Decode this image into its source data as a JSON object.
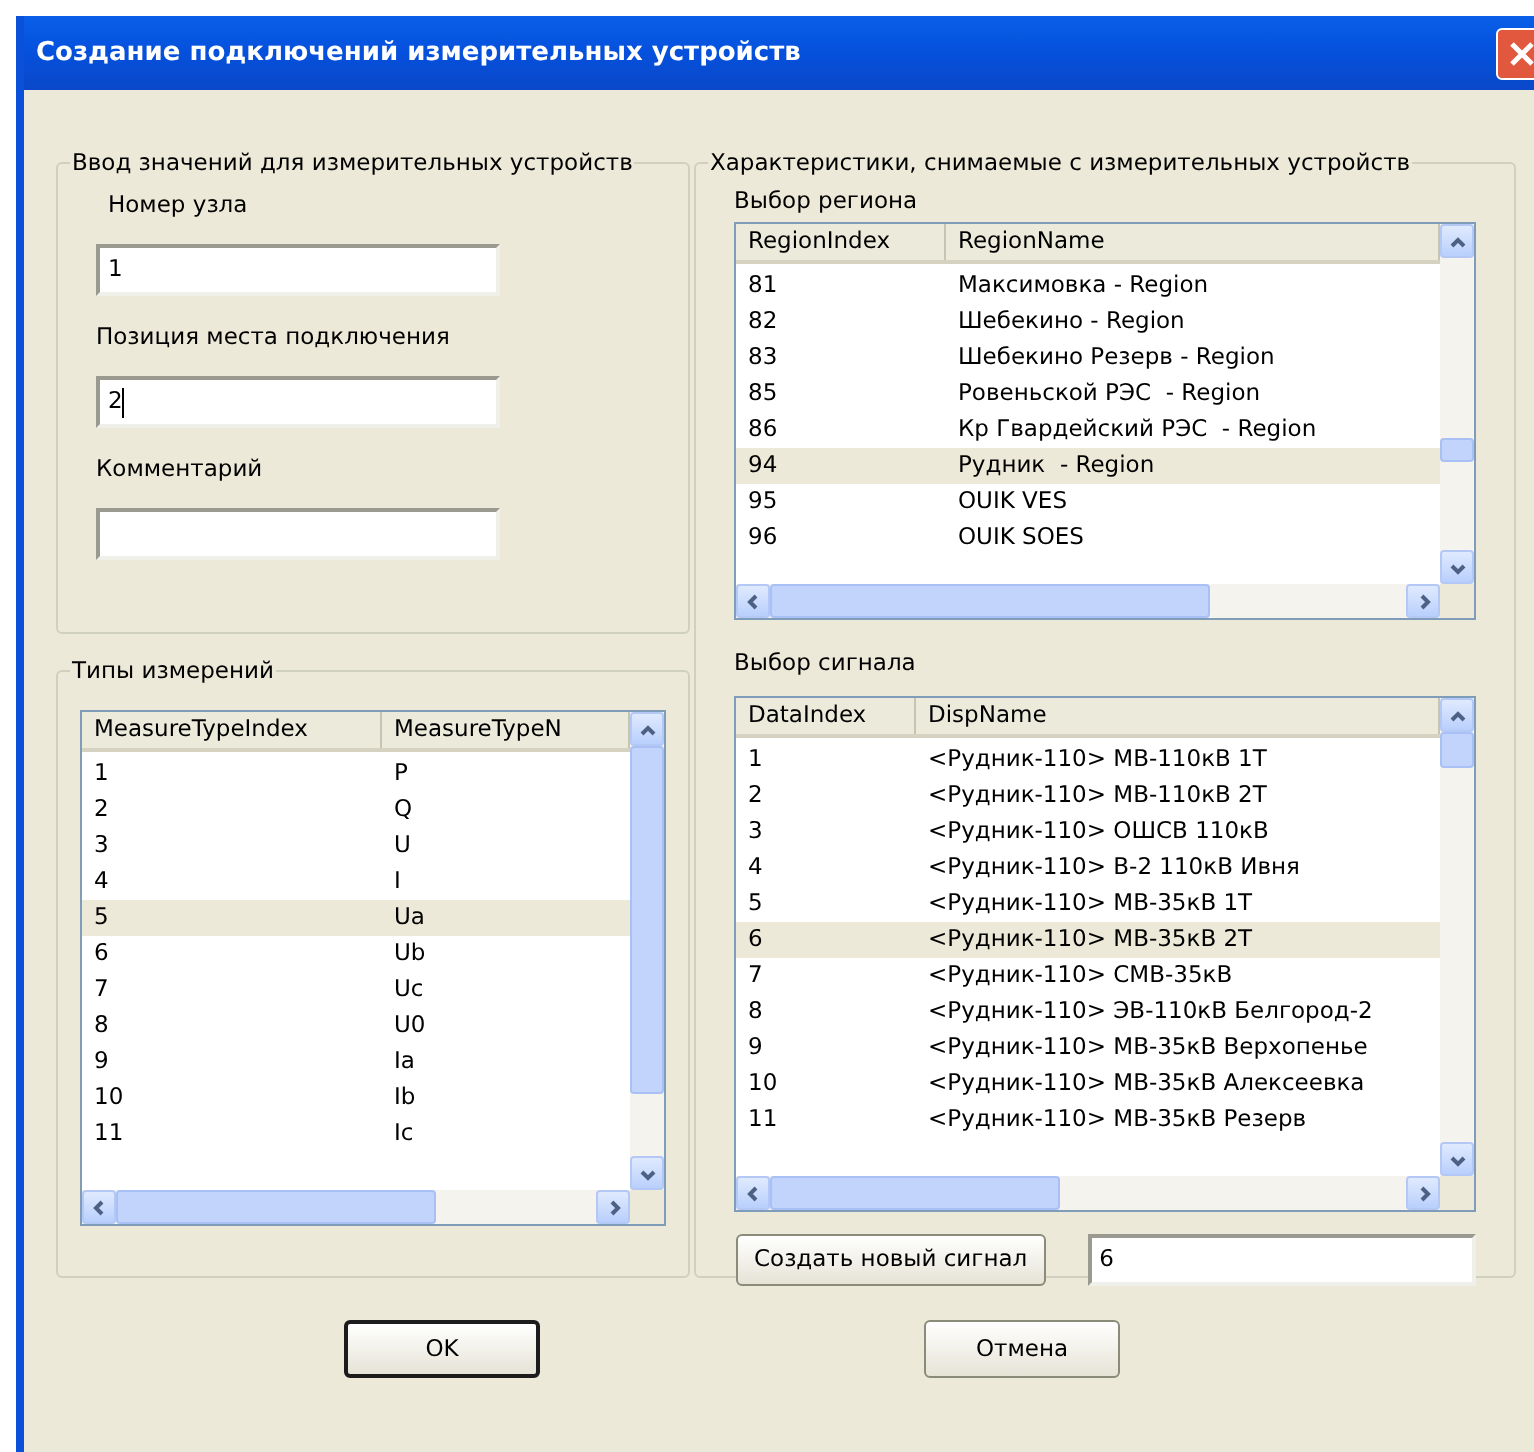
{
  "window": {
    "title": "Создание подключений измерительных устройств"
  },
  "input_group": {
    "title": "Ввод значений для измерительных устройств",
    "fields": [
      {
        "label": "Номер узла",
        "value": "1",
        "focused": false
      },
      {
        "label": "Позиция места подключения",
        "value": "2",
        "focused": true
      },
      {
        "label": "Комментарий",
        "focused": false
      }
    ]
  },
  "measure_types": {
    "title": "Типы измерений",
    "columns": [
      "MeasureTypeIndex",
      "MeasureTypeN"
    ],
    "rows": [
      {
        "cells": [
          "1",
          "P"
        ],
        "selected": false
      },
      {
        "cells": [
          "2",
          "Q"
        ],
        "selected": false
      },
      {
        "cells": [
          "3",
          "U"
        ],
        "selected": false
      },
      {
        "cells": [
          "4",
          "I"
        ],
        "selected": false
      },
      {
        "cells": [
          "5",
          "Ua"
        ],
        "selected": true
      },
      {
        "cells": [
          "6",
          "Ub"
        ],
        "selected": false
      },
      {
        "cells": [
          "7",
          "Uc"
        ],
        "selected": false
      },
      {
        "cells": [
          "8",
          "U0"
        ],
        "selected": false
      },
      {
        "cells": [
          "9",
          "Ia"
        ],
        "selected": false
      },
      {
        "cells": [
          "10",
          "Ib"
        ],
        "selected": false
      },
      {
        "cells": [
          "11",
          "Ic"
        ],
        "selected": false
      }
    ]
  },
  "characteristics": {
    "title": "Характеристики, снимаемые с измерительных устройств",
    "region": {
      "label": "Выбор региона",
      "columns": [
        "RegionIndex",
        "RegionName"
      ],
      "rows": [
        {
          "cells": [
            "81",
            "Максимовка - Region"
          ],
          "selected": false
        },
        {
          "cells": [
            "82",
            "Шебекино - Region"
          ],
          "selected": false
        },
        {
          "cells": [
            "83",
            "Шебекино Резерв - Region"
          ],
          "selected": false
        },
        {
          "cells": [
            "85",
            "Ровеньской РЭС  - Region"
          ],
          "selected": false
        },
        {
          "cells": [
            "86",
            "Кр Гвардейский РЭС  - Region"
          ],
          "selected": false
        },
        {
          "cells": [
            "94",
            "Рудник  - Region"
          ],
          "selected": true
        },
        {
          "cells": [
            "95",
            "OUIK VES"
          ],
          "selected": false
        },
        {
          "cells": [
            "96",
            "OUIK SOES"
          ],
          "selected": false
        }
      ]
    },
    "signal": {
      "label": "Выбор сигнала",
      "columns": [
        "DataIndex",
        "DispName"
      ],
      "rows": [
        {
          "cells": [
            "1",
            "<Рудник-110> МВ-110кВ 1Т"
          ],
          "selected": false
        },
        {
          "cells": [
            "2",
            "<Рудник-110> МВ-110кВ 2Т"
          ],
          "selected": false
        },
        {
          "cells": [
            "3",
            "<Рудник-110> ОШСВ 110кВ"
          ],
          "selected": false
        },
        {
          "cells": [
            "4",
            "<Рудник-110> В-2 110кВ Ивня"
          ],
          "selected": false
        },
        {
          "cells": [
            "5",
            "<Рудник-110> МВ-35кВ 1Т"
          ],
          "selected": false
        },
        {
          "cells": [
            "6",
            "<Рудник-110> МВ-35кВ 2Т"
          ],
          "selected": true
        },
        {
          "cells": [
            "7",
            "<Рудник-110> СМВ-35кВ"
          ],
          "selected": false
        },
        {
          "cells": [
            "8",
            "<Рудник-110> ЭВ-110кВ Белгород-2"
          ],
          "selected": false
        },
        {
          "cells": [
            "9",
            "<Рудник-110> МВ-35кВ Верхопенье"
          ],
          "selected": false
        },
        {
          "cells": [
            "10",
            "<Рудник-110> МВ-35кВ Алексеевка"
          ],
          "selected": false
        },
        {
          "cells": [
            "11",
            "<Рудник-110> МВ-35кВ Резерв"
          ],
          "selected": false
        }
      ]
    },
    "create_button": "Создать новый сигнал",
    "new_signal_value": "6"
  },
  "buttons": [
    {
      "label": "OK",
      "default": true
    },
    {
      "label": "Отмена",
      "default": false
    }
  ]
}
